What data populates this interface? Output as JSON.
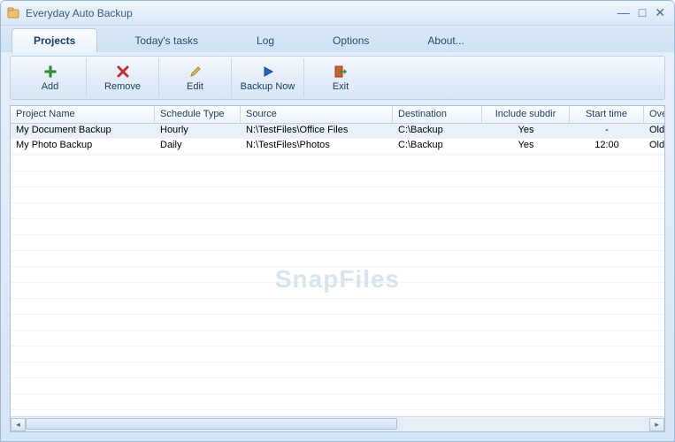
{
  "window": {
    "title": "Everyday Auto Backup"
  },
  "tabs": [
    {
      "label": "Projects",
      "active": true
    },
    {
      "label": "Today's tasks",
      "active": false
    },
    {
      "label": "Log",
      "active": false
    },
    {
      "label": "Options",
      "active": false
    },
    {
      "label": "About...",
      "active": false
    }
  ],
  "toolbar": [
    {
      "label": "Add",
      "icon": "plus-icon"
    },
    {
      "label": "Remove",
      "icon": "delete-icon"
    },
    {
      "label": "Edit",
      "icon": "pencil-icon"
    },
    {
      "label": "Backup Now",
      "icon": "play-icon"
    },
    {
      "label": "Exit",
      "icon": "exit-icon"
    }
  ],
  "columns": [
    "Project Name",
    "Schedule Type",
    "Source",
    "Destination",
    "Include subdir",
    "Start time",
    "Overwrite"
  ],
  "rows": [
    {
      "selected": true,
      "cells": [
        "My Document Backup",
        "Hourly",
        "N:\\TestFiles\\Office Files",
        "C:\\Backup",
        "Yes",
        "-",
        "Old"
      ]
    },
    {
      "selected": false,
      "cells": [
        "My Photo Backup",
        "Daily",
        "N:\\TestFiles\\Photos",
        "C:\\Backup",
        "Yes",
        "12:00",
        "Old"
      ]
    }
  ],
  "watermark": "SnapFiles"
}
